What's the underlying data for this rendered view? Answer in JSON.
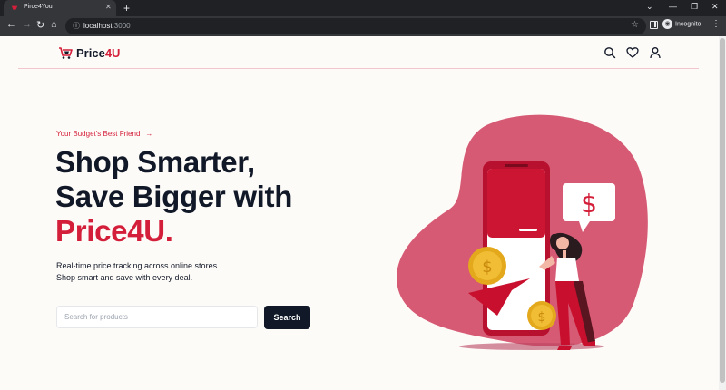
{
  "browser": {
    "tab_title": "Pirce4You",
    "url_host": "localhost",
    "url_port": ":3000",
    "profile_label": "Incognito"
  },
  "header": {
    "logo_text": "Price",
    "logo_accent": "4U"
  },
  "hero": {
    "tagline": "Your Budget's Best Friend",
    "headline_line1": "Shop Smarter,",
    "headline_line2": "Save Bigger with",
    "headline_brand": "Price4U.",
    "description_line1": "Real-time price tracking across online stores.",
    "description_line2": "Shop smart and save with every deal.",
    "search_placeholder": "Search for products",
    "search_button": "Search"
  },
  "colors": {
    "brand": "#d41f3a",
    "dark": "#111827",
    "blob": "#d65a74",
    "background": "#fdfbf8"
  },
  "icons": [
    "search-icon",
    "heart-icon",
    "user-icon",
    "arrow-right-icon",
    "dollar-icon"
  ]
}
